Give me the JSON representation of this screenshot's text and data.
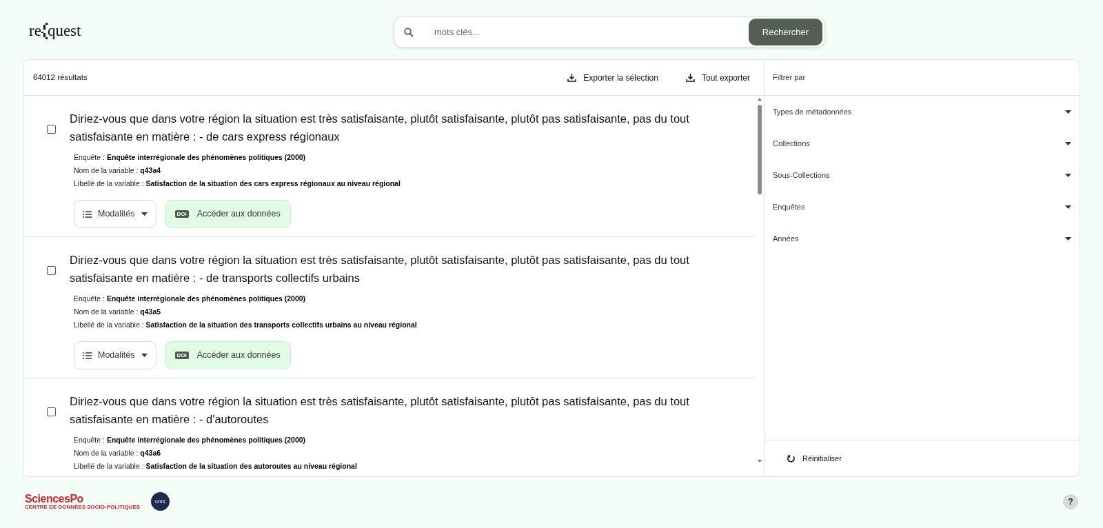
{
  "logo": {
    "before": "re",
    "after": "quest"
  },
  "search": {
    "placeholder": "mots clés...",
    "button": "Rechercher"
  },
  "results_bar": {
    "count": "64012 résultats",
    "actions": [
      "Exporter la sélection",
      "Tout exporter"
    ]
  },
  "results": [
    {
      "checked": false,
      "title": "Diriez-vous que dans votre région la situation est très satisfaisante, plutôt satisfaisante, plutôt pas satisfaisante, pas du tout satisfaisante en matière : - de cars express régionaux",
      "meta": [
        "Enquête : **Enquête interrégionale des phénomènes politiques (2000)**",
        "Nom de la variable : **q43a4**",
        "Libellé de la variable : **Satisfaction de la situation des cars express régionaux au niveau régional**"
      ],
      "modalities": "Modalités",
      "doi_badge": "DOI",
      "access": "Accéder aux données"
    },
    {
      "checked": false,
      "title": "Diriez-vous que dans votre région la situation est très satisfaisante, plutôt satisfaisante, plutôt pas satisfaisante, pas du tout satisfaisante en matière : - de transports collectifs urbains",
      "meta": [
        "Enquête : **Enquête interrégionale des phénomènes politiques (2000)**",
        "Nom de la variable : **q43a5**",
        "Libellé de la variable : **Satisfaction de la situation des transports collectifs urbains au niveau régional**"
      ],
      "modalities": "Modalités",
      "doi_badge": "DOI",
      "access": "Accéder aux données"
    },
    {
      "checked": false,
      "title": "Diriez-vous que dans votre région la situation est très satisfaisante, plutôt satisfaisante, plutôt pas satisfaisante, pas du tout satisfaisante en matière : - d'autoroutes",
      "meta": [
        "Enquête : **Enquête interrégionale des phénomènes politiques (2000)**",
        "Nom de la variable : **q43a6**",
        "Libellé de la variable : **Satisfaction de la situation des autoroutes au niveau régional**"
      ]
    }
  ],
  "filters": {
    "heading": "Filtrer par",
    "items": [
      {
        "label": "Types de métadonnées",
        "expanded": false
      },
      {
        "label": "Collections",
        "expanded": false
      },
      {
        "label": "Sous-Collections",
        "expanded": false
      },
      {
        "label": "Enquêtes",
        "expanded": false
      },
      {
        "label": "Années",
        "expanded": false
      }
    ],
    "reset": "Réinitialiser"
  },
  "footer": {
    "sciencespo": "SciencesPo",
    "sciencespo_sub": "CENTRE DE DONNÉES SOCIO-POLITIQUES",
    "cnrs": "cnrs",
    "help": "?"
  }
}
